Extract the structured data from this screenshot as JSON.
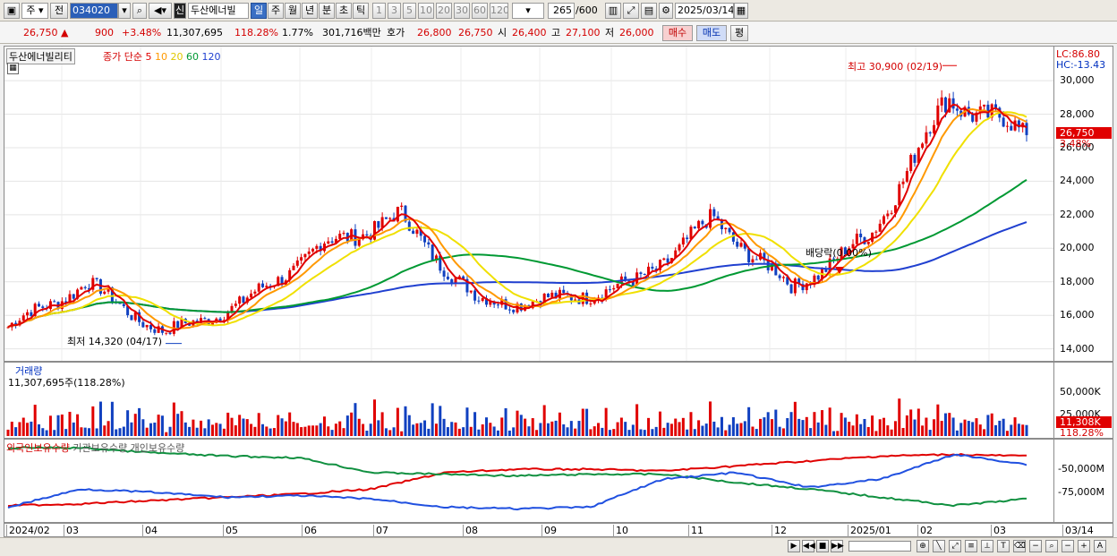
{
  "toolbar": {
    "market": "주",
    "prev": "전",
    "code": "034020",
    "new_tag": "신",
    "name": "두산에너빌",
    "periods": [
      "일",
      "주",
      "월",
      "년",
      "분",
      "초",
      "틱"
    ],
    "selected_period": "일",
    "intervals": [
      "1",
      "3",
      "5",
      "10",
      "20",
      "30",
      "60",
      "120"
    ],
    "count": "265",
    "count_max": "/600",
    "date": "2025/03/14"
  },
  "quote": {
    "price": "26,750",
    "arrow": "▲",
    "change": "900",
    "change_pct": "+3.48%",
    "volume": "11,307,695",
    "vol_ratio": "118.28%",
    "turnover": "1.77%",
    "amount": "301,716백만",
    "ask_label": "호가",
    "ask": "26,800",
    "bid": "26,750",
    "open_label": "시",
    "open": "26,400",
    "high_label": "고",
    "high": "27,100",
    "low_label": "저",
    "low": "26,000",
    "buy": "매수",
    "sell": "매도",
    "eval": "평"
  },
  "price_panel": {
    "legend_name": "두산에너빌리티",
    "legend_ma": "종가 단순",
    "ma_periods": [
      "5",
      "10",
      "20",
      "60",
      "120"
    ],
    "lc": "LC:86.80",
    "hc": "HC:-13.43",
    "high_note": "최고 30,900 (02/19)",
    "low_note": "최저 14,320 (04/17)",
    "dividend_note": "배당락(0.00%)",
    "last_price": "26,750",
    "last_pct": "3.48%",
    "y_ticks": [
      "30,000",
      "28,000",
      "26,000",
      "24,000",
      "22,000",
      "20,000",
      "18,000",
      "16,000",
      "14,000"
    ]
  },
  "volume_panel": {
    "title": "거래량",
    "value": "11,307,695주(118.28%)",
    "y_ticks": [
      "50,000K",
      "25,000K"
    ],
    "last_value": "11,308K",
    "last_pct": "118.28%"
  },
  "holding_panel": {
    "legend": [
      "외국인보유수량",
      "기관보유수량",
      "개인보유수량"
    ],
    "y_ticks": [
      "-50,000M",
      "-75,000M"
    ]
  },
  "x_axis": {
    "labels": [
      "2024/02",
      "03",
      "04",
      "05",
      "06",
      "07",
      "08",
      "09",
      "10",
      "11",
      "12",
      "2025/01",
      "02",
      "03",
      "03/14"
    ]
  },
  "colors": {
    "ma5": "#e00000",
    "ma10": "#ff9900",
    "ma20": "#f0e000",
    "ma60": "#009933",
    "ma120": "#2040d0",
    "up": "#e00000",
    "down": "#1040c0",
    "foreign": "#e00000",
    "institution": "#109040",
    "individual": "#2050e0"
  },
  "chart_data": {
    "type": "line",
    "title": "두산에너빌리티",
    "x": [
      "2024/02",
      "2024/03",
      "2024/04",
      "2024/05",
      "2024/06",
      "2024/07",
      "2024/08",
      "2024/09",
      "2024/10",
      "2024/11",
      "2024/12",
      "2025/01",
      "2025/02",
      "2025/03"
    ],
    "ylim": [
      13500,
      31500
    ],
    "series": [
      {
        "name": "종가",
        "values": [
          15300,
          17900,
          14900,
          16700,
          20100,
          21900,
          16800,
          16900,
          17900,
          21700,
          17600,
          20700,
          29000,
          26750
        ]
      },
      {
        "name": "60",
        "values": [
          15300,
          15900,
          16300,
          16600,
          17400,
          18800,
          18500,
          18300,
          18100,
          18700,
          19400,
          19900,
          21600,
          22700
        ]
      },
      {
        "name": "120",
        "values": [
          15300,
          15500,
          15600,
          15900,
          16500,
          17300,
          18000,
          18100,
          18200,
          18700,
          19000,
          19300,
          20200,
          21200
        ]
      }
    ],
    "annotations": [
      {
        "text": "최고 30,900 (02/19)",
        "x": "2025/02/19",
        "y": 30900
      },
      {
        "text": "최저 14,320 (04/17)",
        "x": "2024/04/17",
        "y": 14320
      }
    ],
    "volume": {
      "name": "거래량",
      "last": 11307695,
      "ylim": [
        0,
        70000000
      ]
    },
    "holdings": [
      {
        "name": "외국인보유수량"
      },
      {
        "name": "기관보유수량"
      },
      {
        "name": "개인보유수량"
      }
    ]
  }
}
